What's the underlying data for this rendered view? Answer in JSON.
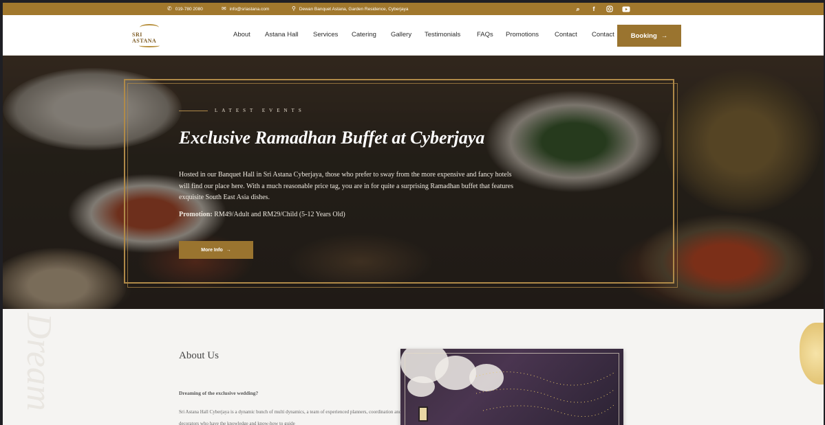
{
  "topbar": {
    "phone": "019-780 2080",
    "email": "info@sriastana.com",
    "address": "Dewan Banquet Astana, Garden Residence, Cyberjaya",
    "social": [
      "search-icon",
      "facebook-icon",
      "instagram-icon",
      "youtube-icon"
    ]
  },
  "logo": {
    "text": "SRI ASTANA"
  },
  "nav": {
    "items": [
      "About",
      "Astana Hall",
      "Services",
      "Catering",
      "Gallery",
      "Testimonials",
      "FAQs",
      "Promotions",
      "Contact",
      "Contact"
    ],
    "booking": "Booking"
  },
  "hero": {
    "eyebrow": "LATEST EVENTS",
    "title": "Exclusive Ramadhan Buffet at Cyberjaya",
    "description": "Hosted in our Banquet Hall in Sri Astana Cyberjaya, those who prefer to sway from the more expensive and fancy hotels will find our place here. With a much reasonable price tag, you are in for quite a surprising Ramadhan buffet that features exquisite South East Asia dishes.",
    "promo_label": "Promotion:",
    "promo_value": " RM49/Adult and RM29/Child (5-12 Years Old)",
    "button": "More Info"
  },
  "about": {
    "watermark": "Dream",
    "title": "About Us",
    "subtitle": "Dreaming of the exclusive wedding?",
    "text": "Sri Astana Hall Cyberjaya is a dynamic bunch of multi dynamics, a team of experienced planners, coordination and decorators who have the knowledge and know-how to guide"
  },
  "colors": {
    "gold": "#a1782d",
    "button": "#9a742f",
    "frame": "#b08a48"
  }
}
